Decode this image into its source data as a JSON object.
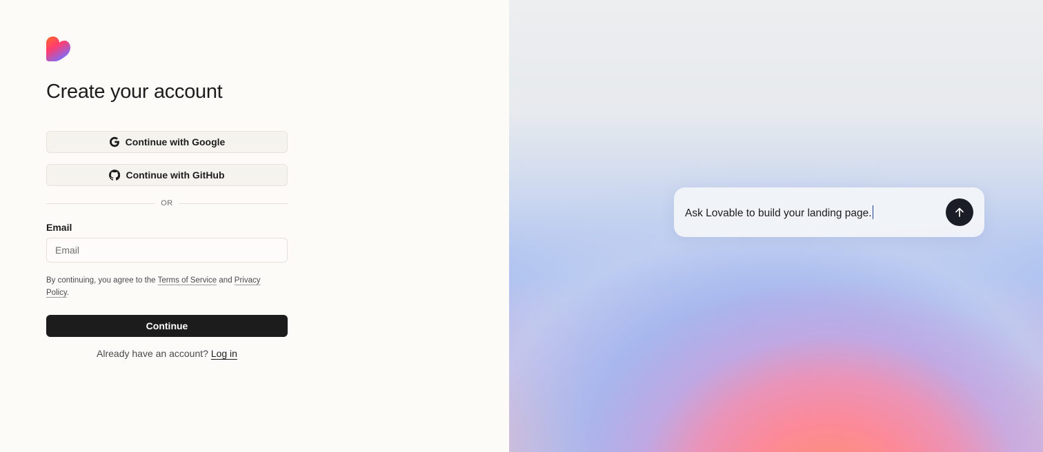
{
  "auth": {
    "title": "Create your account",
    "google_label": "Continue with Google",
    "github_label": "Continue with GitHub",
    "divider_text": "OR",
    "email_label": "Email",
    "email_placeholder": "Email",
    "email_value": "",
    "terms_prefix": "By continuing, you agree to the",
    "terms_of_service": "Terms of Service",
    "terms_and": "and",
    "privacy_policy": "Privacy Policy",
    "terms_suffix": ".",
    "continue_label": "Continue",
    "login_prompt": "Already have an account?",
    "login_link": "Log in"
  },
  "hero": {
    "prompt_text": "Ask Lovable to build your landing page.",
    "send_icon": "arrow-up-icon"
  },
  "colors": {
    "primary_button": "#1c1c1c",
    "left_background": "#fcfbf8",
    "oauth_button_bg": "#f5f3ee"
  }
}
